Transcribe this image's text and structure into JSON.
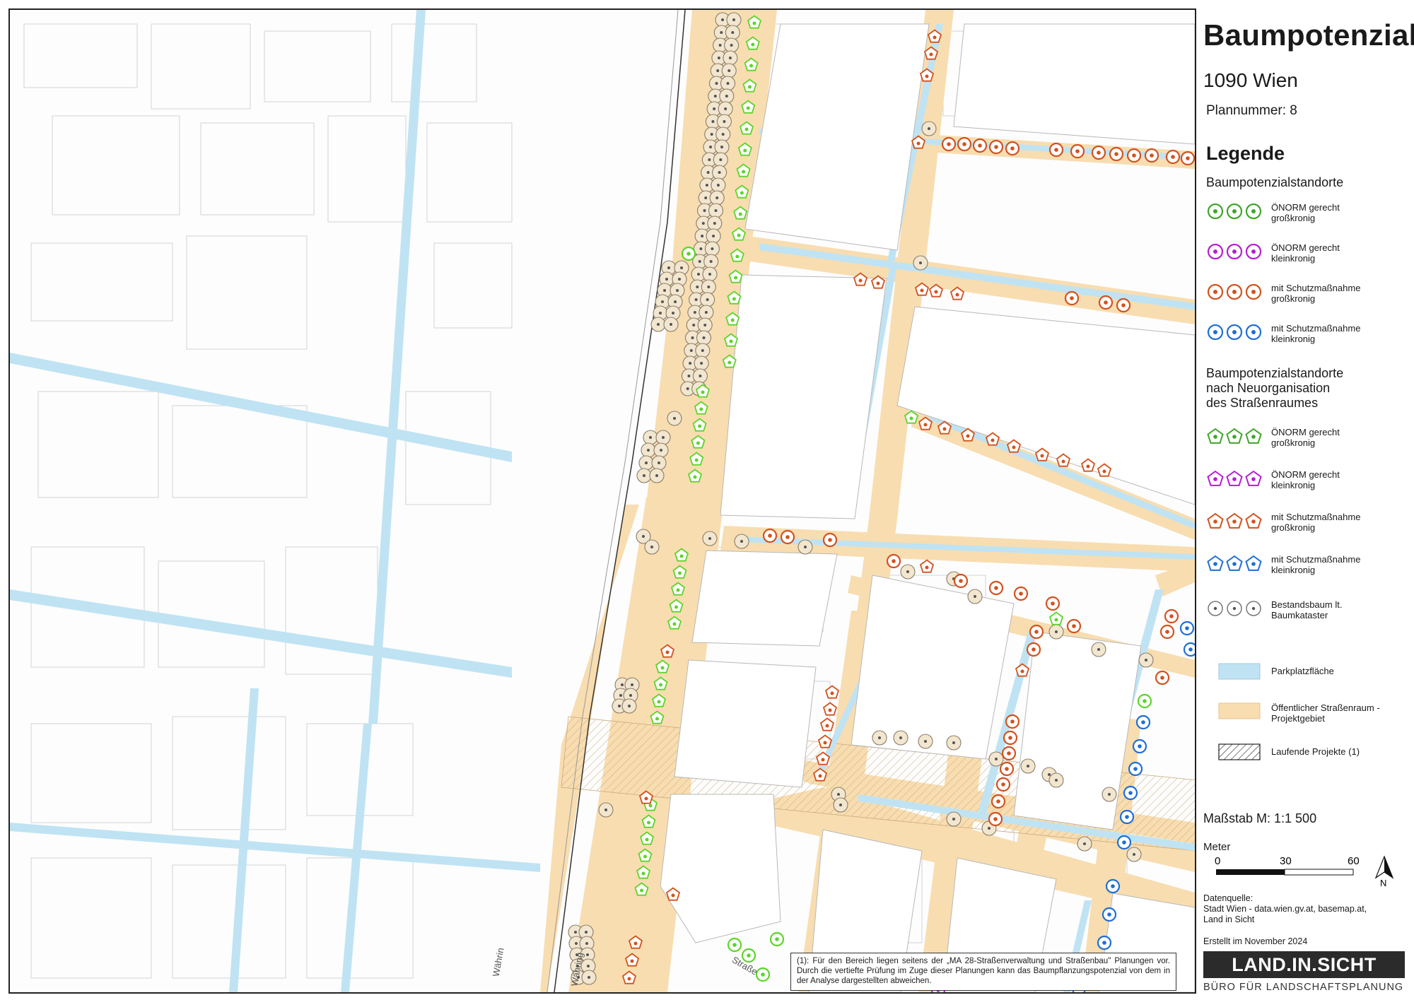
{
  "title": "Baumpotenzial",
  "subtitle": "1090 Wien",
  "plan_number": "Plannummer: 8",
  "legend": {
    "heading": "Legende",
    "section1": "Baumpotenzialstandorte",
    "section2_lines": [
      "Baumpotenzialstandorte",
      "nach Neuorganisation",
      "des Straßenraumes"
    ],
    "items_circle": [
      {
        "id": "c-green",
        "color": "#3fa52a",
        "line1": "ÖNORM gerecht",
        "line2": "großkronig"
      },
      {
        "id": "c-purple",
        "color": "#b41fd0",
        "line1": "ÖNORM gerecht",
        "line2": "kleinkronig"
      },
      {
        "id": "c-orange",
        "color": "#d2521e",
        "line1": "mit Schutzmaßnahme",
        "line2": "großkronig"
      },
      {
        "id": "c-blue",
        "color": "#1f6fd4",
        "line1": "mit Schutzmaßnahme",
        "line2": "kleinkronig"
      }
    ],
    "items_pentagon": [
      {
        "id": "p-green",
        "color": "#3fa52a",
        "line1": "ÖNORM gerecht",
        "line2": "großkronig"
      },
      {
        "id": "p-purple",
        "color": "#b41fd0",
        "line1": "ÖNORM gerecht",
        "line2": "kleinkronig"
      },
      {
        "id": "p-orange",
        "color": "#d2521e",
        "line1": "mit Schutzmaßnahme",
        "line2": "großkronig"
      },
      {
        "id": "p-blue",
        "color": "#1f6fd4",
        "line1": "mit Schutzmaßnahme",
        "line2": "kleinkronig"
      }
    ],
    "existing": {
      "color": "#777777",
      "line1": "Bestandsbaum lt.",
      "line2": "Baumkataster"
    },
    "parking": {
      "color": "#bfe3f3",
      "label": "Parkplatzfläche"
    },
    "street_space": {
      "color": "#f8ddb0",
      "line1": "Öffentlicher Straßenraum -",
      "line2": "Projektgebiet"
    },
    "projects": {
      "label": "Laufende Projekte (1)"
    }
  },
  "scale": {
    "text": "Maßstab M: 1:1 500",
    "unit": "Meter",
    "ticks": [
      "0",
      "30",
      "60"
    ],
    "north": "N"
  },
  "source": {
    "line1": "Datenquelle:",
    "line2": "Stadt Wien - data.wien.gv.at, basemap.at,",
    "line3": "Land in Sicht"
  },
  "created": "Erstellt im November 2024",
  "logo": {
    "text": "LAND.IN.SICHT",
    "sub": "BÜRO FÜR LANDSCHAFTSPLANUNG"
  },
  "note": "(1): Für den Bereich liegen seitens der „MA 28-Straßenverwaltung und Straßenbau\" Planungen vor. Durch die vertiefte Prüfung im Zuge dieser Planungen kann das Baumpflanzungspotenzial von dem in der Analyse dargestellten abweichen.",
  "street_labels": {
    "a": "Währin",
    "b": "Währing",
    "c": "Straße"
  },
  "colors": {
    "street": "#f8ddb0",
    "parking": "#bfe3f3",
    "green": "#3fa52a",
    "lightgreen": "#5ed42a",
    "orange": "#d2521e",
    "blue": "#1f6fd4",
    "purple": "#b41fd0",
    "existing": "#8a7d6a"
  }
}
